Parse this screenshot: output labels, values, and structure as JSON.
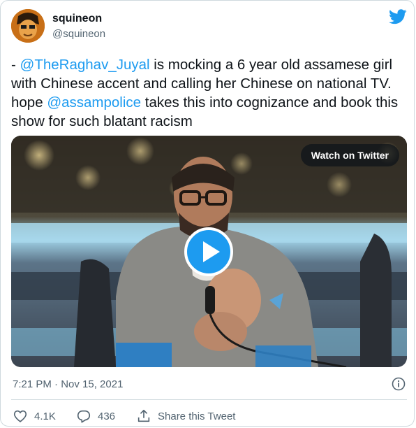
{
  "tweet": {
    "display_name": "squineon",
    "handle": "@squineon",
    "text_parts": {
      "prefix": "- ",
      "mention_1": "@TheRaghav_Juyal",
      "middle": " is mocking a 6 year old assamese girl with Chinese accent and calling her Chinese on national TV. hope ",
      "mention_2": "@assampolice",
      "suffix": " takes this into cognizance and book this show for such blatant racism"
    },
    "timestamp": "7:21 PM · Nov 15, 2021"
  },
  "media": {
    "watch_label": "Watch on Twitter"
  },
  "actions": {
    "like_count": "4.1K",
    "reply_count": "436",
    "share_label": "Share this Tweet"
  },
  "colors": {
    "accent": "#1d9bf0",
    "text": "#0f1419",
    "secondary": "#536471"
  },
  "icons": [
    "twitter-bird-icon",
    "play-icon",
    "info-icon",
    "heart-icon",
    "reply-icon",
    "share-icon"
  ]
}
